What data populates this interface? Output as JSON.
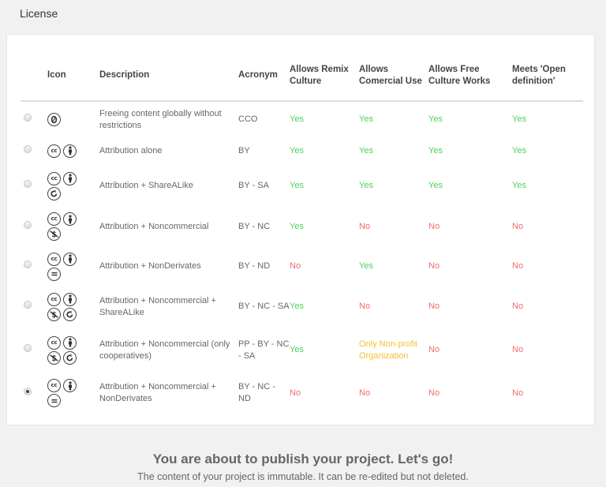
{
  "section_title": "License",
  "headers": {
    "icon": "Icon",
    "description": "Description",
    "acronym": "Acronym",
    "remix": "Allows Remix Culture",
    "commercial": "Allows Comercial Use",
    "free": "Allows Free Culture Works",
    "open": "Meets 'Open definition'"
  },
  "rows": [
    {
      "selected": false,
      "icons": [
        "zero-icon"
      ],
      "description": "Freeing content globally without restrictions",
      "acronym": "CCO",
      "remix": "Yes",
      "commercial": "Yes",
      "free": "Yes",
      "open": "Yes"
    },
    {
      "selected": false,
      "icons": [
        "cc-icon",
        "by-icon"
      ],
      "description": "Attribution alone",
      "acronym": "BY",
      "remix": "Yes",
      "commercial": "Yes",
      "free": "Yes",
      "open": "Yes"
    },
    {
      "selected": false,
      "icons": [
        "cc-icon",
        "by-icon",
        "sa-icon"
      ],
      "description": "Attribution + ShareALike",
      "acronym": "BY - SA",
      "remix": "Yes",
      "commercial": "Yes",
      "free": "Yes",
      "open": "Yes"
    },
    {
      "selected": false,
      "icons": [
        "cc-icon",
        "by-icon",
        "nc-icon"
      ],
      "description": "Attribution + Noncommercial",
      "acronym": "BY - NC",
      "remix": "Yes",
      "commercial": "No",
      "free": "No",
      "open": "No"
    },
    {
      "selected": false,
      "icons": [
        "cc-icon",
        "by-icon",
        "nd-icon"
      ],
      "description": "Attribution + NonDerivates",
      "acronym": "BY - ND",
      "remix": "No",
      "commercial": "Yes",
      "free": "No",
      "open": "No"
    },
    {
      "selected": false,
      "icons": [
        "cc-icon",
        "by-icon",
        "nc-icon",
        "sa-icon"
      ],
      "description": "Attribution + Noncommercial + ShareALike",
      "acronym": "BY - NC - SA",
      "remix": "Yes",
      "commercial": "No",
      "free": "No",
      "open": "No"
    },
    {
      "selected": false,
      "icons": [
        "cc-icon",
        "by-icon",
        "nc-icon",
        "sa-icon"
      ],
      "description": "Attribution + Noncommercial (only cooperatives)",
      "acronym": "PP - BY - NC - SA",
      "remix": "Yes",
      "commercial": "Only Non-profit Organization",
      "free": "No",
      "open": "No"
    },
    {
      "selected": true,
      "icons": [
        "cc-icon",
        "by-icon",
        "nd-icon"
      ],
      "description": "Attribution + Noncommercial + NonDerivates",
      "acronym": "BY - NC - ND",
      "remix": "No",
      "commercial": "No",
      "free": "No",
      "open": "No"
    }
  ],
  "colors": {
    "yes": "#4cd15a",
    "no": "#f26b6b",
    "only": "#f3c232"
  },
  "publish": {
    "title": "You are about to publish your project. Let's go!",
    "subtitle": "The content of your project is immutable. It can be re-edited but not deleted."
  }
}
